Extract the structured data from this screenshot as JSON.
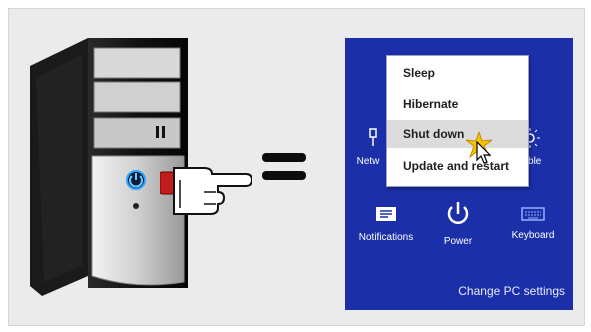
{
  "charms": {
    "network_label": "Netw",
    "available_label": "ilable",
    "notifications_label": "Notifications",
    "power_label": "Power",
    "keyboard_label": "Keyboard",
    "change_pc_settings": "Change PC settings"
  },
  "power_menu": {
    "items": [
      {
        "label": "Sleep"
      },
      {
        "label": "Hibernate"
      },
      {
        "label": "Shut down",
        "highlighted": true
      },
      {
        "label": "Update and restart"
      }
    ]
  },
  "colors": {
    "panel_bg": "#1b2fa8",
    "menu_highlight": "#dcdcdc",
    "power_button_glow": "#2aa3ff"
  },
  "icons": {
    "computer": "pc-tower-icon",
    "hand": "pointing-hand-icon",
    "equals": "equals-sign",
    "network": "network-icon",
    "available": "brightness-icon",
    "notifications": "notifications-icon",
    "power": "power-icon",
    "keyboard": "keyboard-icon",
    "cursor": "mouse-cursor-icon",
    "click_burst": "click-burst-icon"
  }
}
